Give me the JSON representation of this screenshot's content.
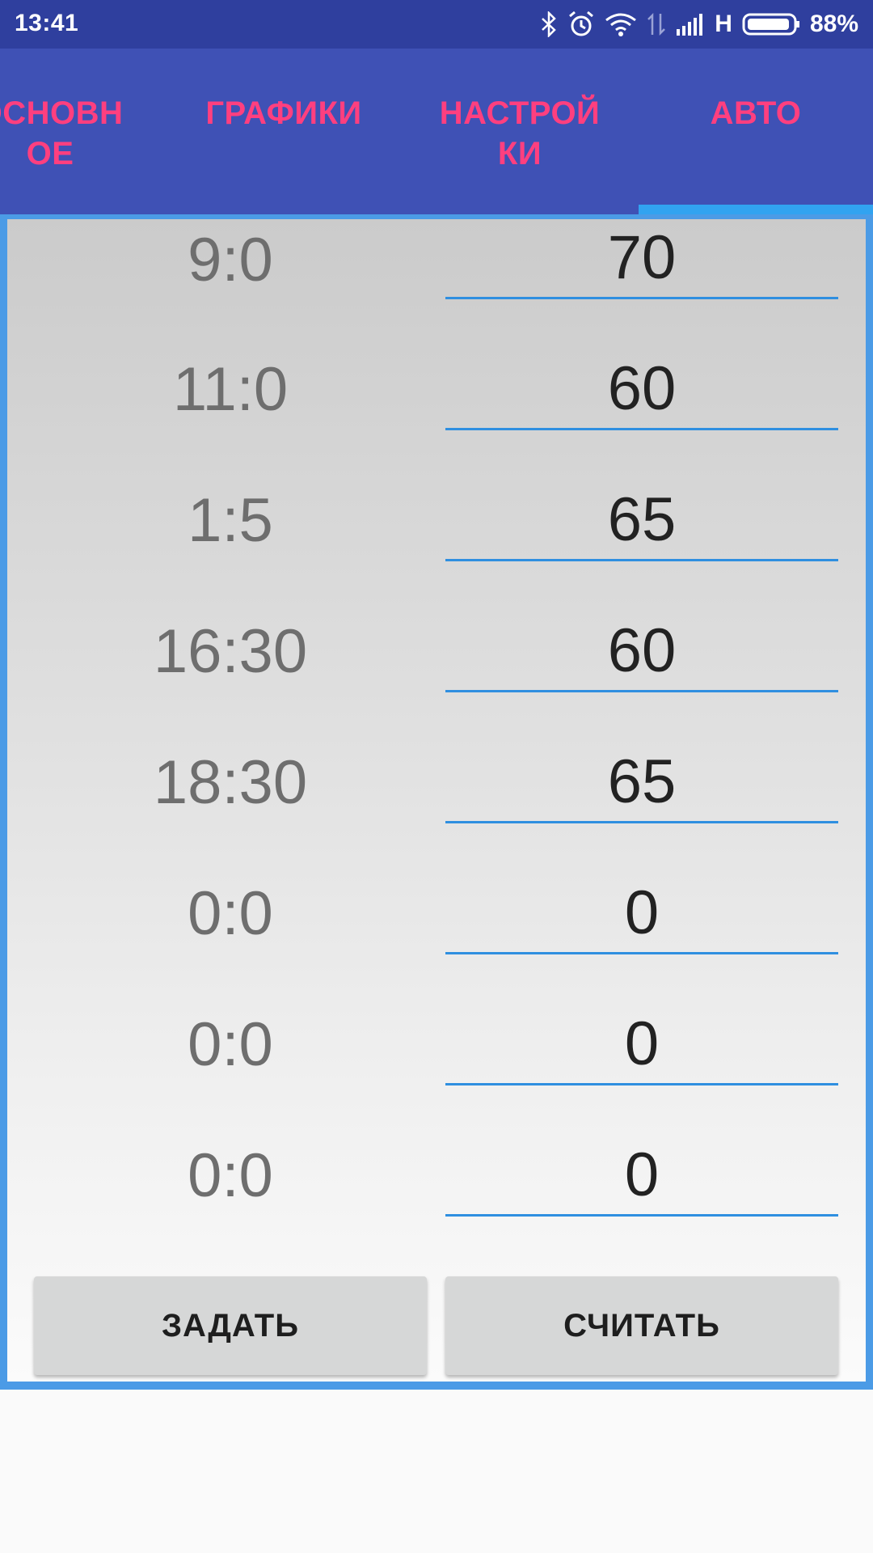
{
  "status_bar": {
    "time": "13:41",
    "network_type": "H",
    "battery": "88%",
    "icons": [
      "bluetooth-icon",
      "alarm-icon",
      "wifi-icon",
      "data-arrows-icon",
      "signal-icon",
      "battery-icon"
    ]
  },
  "tabs": [
    {
      "label": "ОСНОВН\nОЕ",
      "selected": false
    },
    {
      "label": "ГРАФИКИ",
      "selected": false
    },
    {
      "label": "НАСТРОЙ\nКИ",
      "selected": false
    },
    {
      "label": "АВТО",
      "selected": true
    }
  ],
  "schedule": {
    "rows": [
      {
        "time": "9:0",
        "value": "70"
      },
      {
        "time": "11:0",
        "value": "60"
      },
      {
        "time": "1:5",
        "value": "65"
      },
      {
        "time": "16:30",
        "value": "60"
      },
      {
        "time": "18:30",
        "value": "65"
      },
      {
        "time": "0:0",
        "value": "0"
      },
      {
        "time": "0:0",
        "value": "0"
      },
      {
        "time": "0:0",
        "value": "0"
      }
    ]
  },
  "buttons": {
    "set_label": "ЗАДАТЬ",
    "read_label": "СЧИТАТЬ"
  },
  "colors": {
    "status_bar": "#2f3f9e",
    "tab_bar": "#3f51b5",
    "tab_text": "#ff3f7f",
    "indicator": "#31a3f0",
    "field_underline": "#2f8fe0"
  }
}
